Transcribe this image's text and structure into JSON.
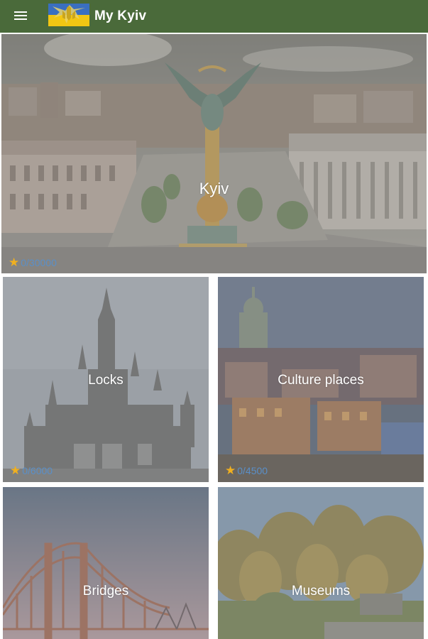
{
  "app": {
    "title": "My Kyiv",
    "toolbar_color": "#4a6a3a",
    "menu_icon": "hamburger-menu-icon",
    "logo": "ukraine-trident-flag-logo"
  },
  "tiles": [
    {
      "id": "kyiv",
      "label": "Kyiv",
      "score": "0/30000",
      "score_icon": "star-icon"
    },
    {
      "id": "locks",
      "label": "Locks",
      "score": "0/6000",
      "score_icon": "star-icon"
    },
    {
      "id": "culture",
      "label": "Culture places",
      "score": "0/4500",
      "score_icon": "star-icon"
    },
    {
      "id": "bridges",
      "label": "Bridges"
    },
    {
      "id": "museums",
      "label": "Museums"
    }
  ],
  "colors": {
    "star": "#f0b020",
    "score_text": "#5a8fc8",
    "overlay": "rgba(150,150,150,0.42)"
  }
}
